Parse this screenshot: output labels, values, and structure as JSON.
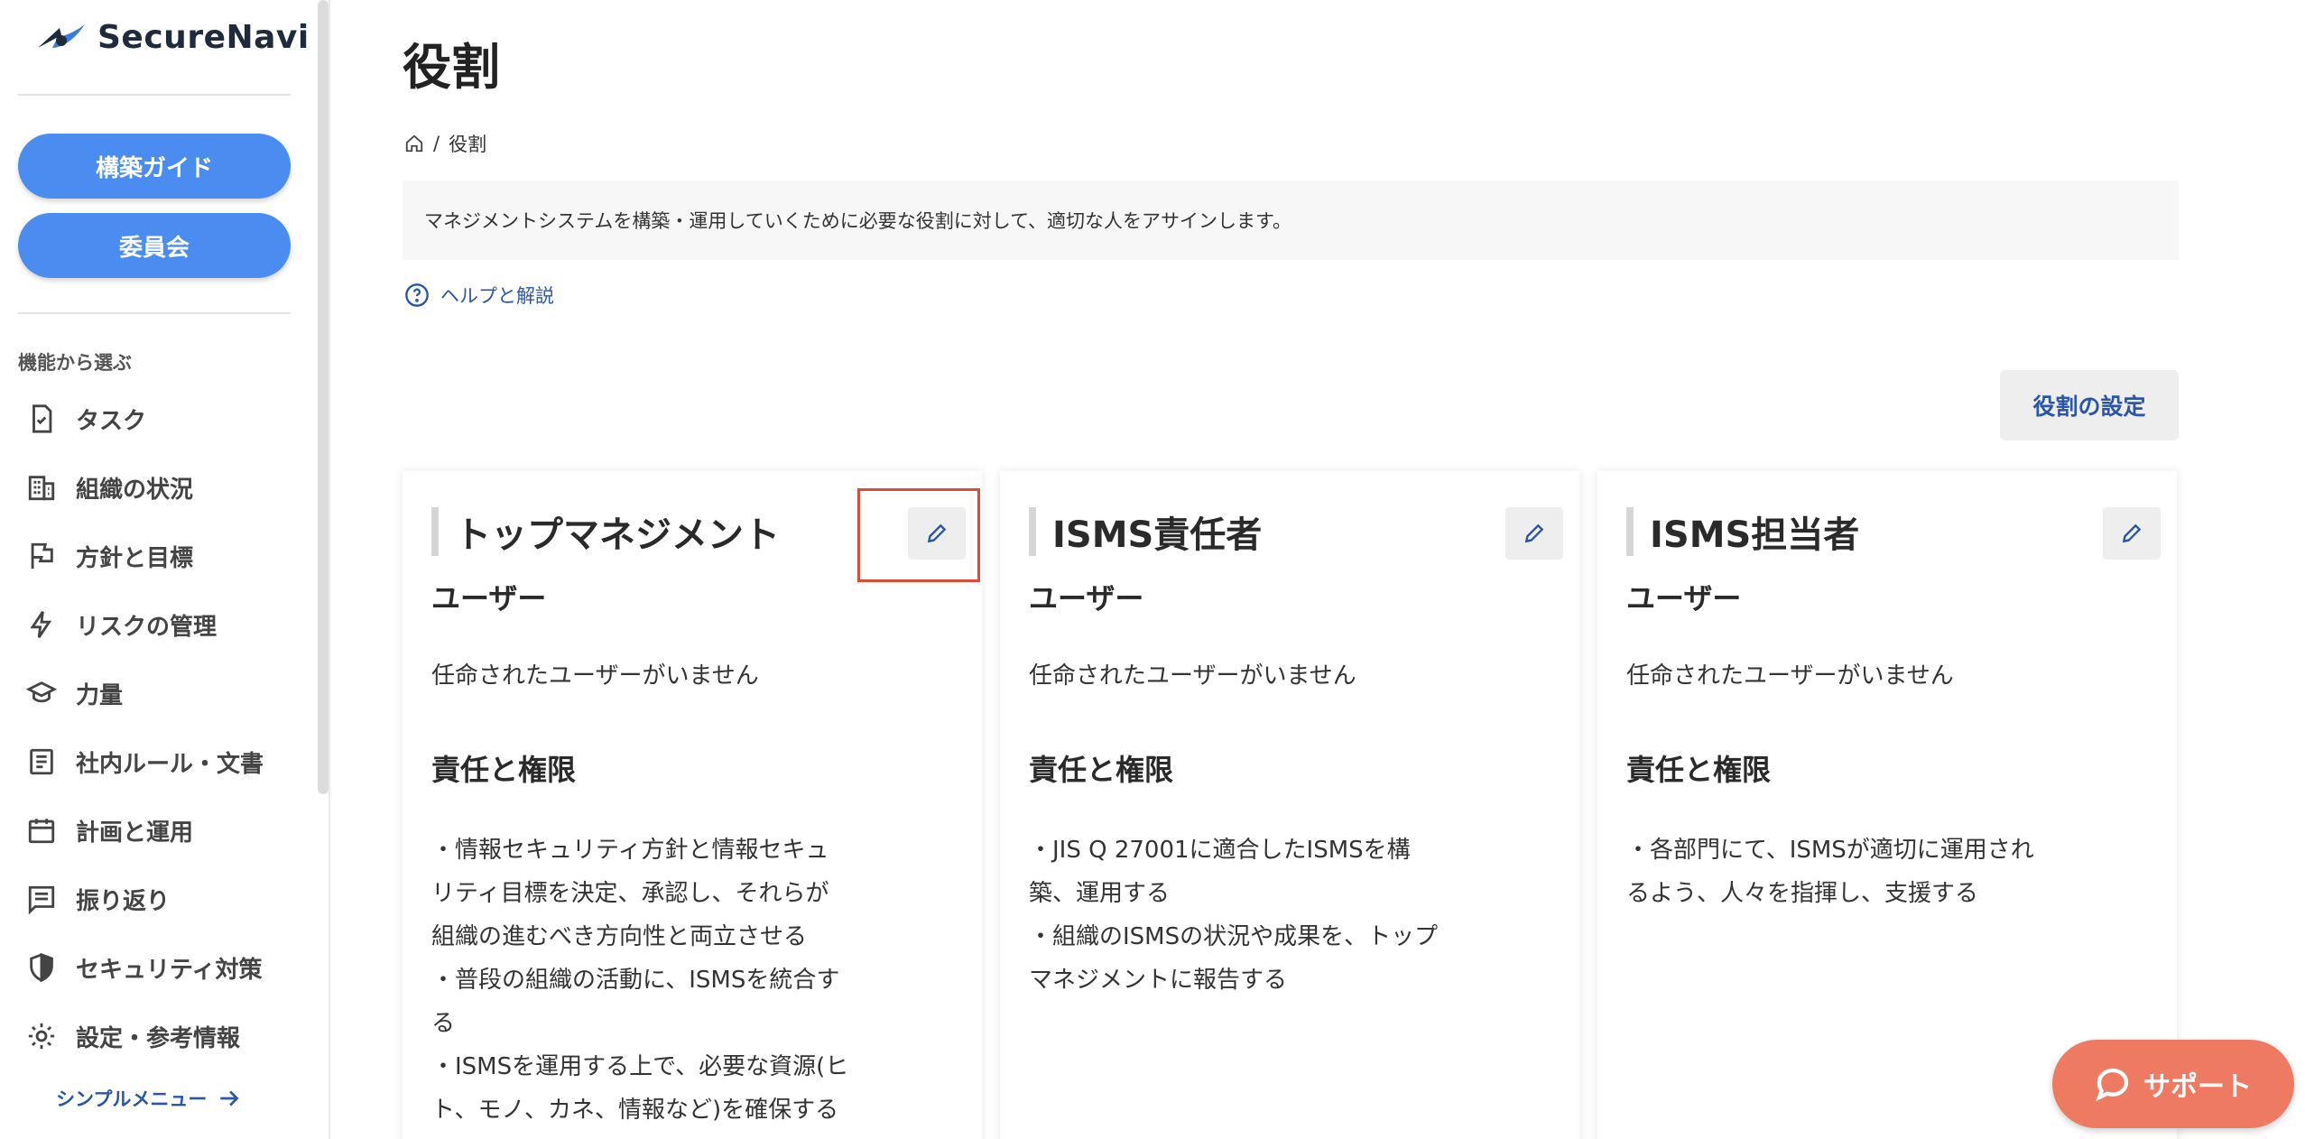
{
  "sidebar": {
    "logo_text": "SecureNavi",
    "buttons": [
      {
        "label": "構築ガイド"
      },
      {
        "label": "委員会"
      }
    ],
    "section_label": "機能から選ぶ",
    "items": [
      {
        "label": "タスク",
        "icon": "task-check-icon"
      },
      {
        "label": "組織の状況",
        "icon": "building-icon"
      },
      {
        "label": "方針と目標",
        "icon": "flag-icon"
      },
      {
        "label": "リスクの管理",
        "icon": "lightning-icon"
      },
      {
        "label": "力量",
        "icon": "graduation-cap-icon"
      },
      {
        "label": "社内ルール・文書",
        "icon": "document-icon"
      },
      {
        "label": "計画と運用",
        "icon": "calendar-icon"
      },
      {
        "label": "振り返り",
        "icon": "message-lines-icon"
      },
      {
        "label": "セキュリティ対策",
        "icon": "shield-icon"
      },
      {
        "label": "設定・参考情報",
        "icon": "gear-icon"
      }
    ],
    "simple_menu": "シンプルメニュー"
  },
  "main": {
    "title": "役割",
    "breadcrumb": {
      "separator": "/",
      "current": "役割"
    },
    "description": "マネジメントシステムを構築・運用していくために必要な役割に対して、適切な人をアサインします。",
    "help_link": "ヘルプと解説",
    "settings_button": "役割の設定",
    "cards": [
      {
        "title": "トップマネジメント",
        "users_heading": "ユーザー",
        "users_empty": "任命されたユーザーがいません",
        "resp_heading": "責任と権限",
        "resp_lines": [
          "・情報セキュリティ方針と情報セキュ",
          "リティ目標を決定、承認し、それらが",
          "組織の進むべき方向性と両立させる",
          "・普段の組織の活動に、ISMSを統合す",
          "る",
          "・ISMSを運用する上で、必要な資源(ヒ",
          "ト、モノ、カネ、情報など)を確保する"
        ]
      },
      {
        "title": "ISMS責任者",
        "users_heading": "ユーザー",
        "users_empty": "任命されたユーザーがいません",
        "resp_heading": "責任と権限",
        "resp_lines": [
          "・JIS Q 27001に適合したISMSを構",
          "築、運用する",
          "・組織のISMSの状況や成果を、トップ",
          "マネジメントに報告する"
        ]
      },
      {
        "title": "ISMS担当者",
        "users_heading": "ユーザー",
        "users_empty": "任命されたユーザーがいません",
        "resp_heading": "責任と権限",
        "resp_lines": [
          "・各部門にて、ISMSが適切に運用され",
          "るよう、人々を指揮し、支援する"
        ]
      }
    ]
  },
  "support_button": "サポート",
  "colors": {
    "primary_button": "#4a8cf0",
    "link": "#2a56a8",
    "support": "#ef7a62",
    "highlight": "#e04a36"
  }
}
